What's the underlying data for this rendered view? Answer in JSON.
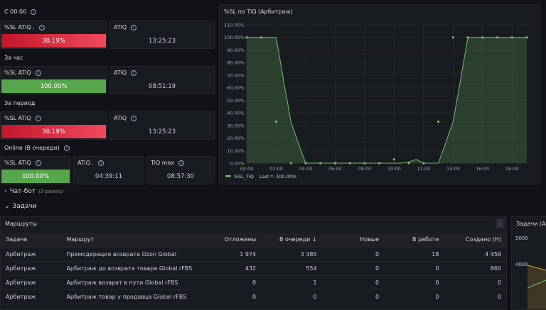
{
  "left": {
    "sec1": "С 00:00",
    "sec2": "За час",
    "sec3": "За период",
    "sec4": "Online (В очереди)",
    "s1_title": "%SL ATiQ .",
    "s1_value": "30.19%",
    "s2_title": "ATiQ",
    "s2_value": "13:25:23",
    "s3_title": "%SL ATiQ",
    "s3_value": "100.00%",
    "s4_title": "ATiQ",
    "s4_value": "08:51:19",
    "s5_title": "%SL ATiQ",
    "s5_value": "30.19%",
    "s6_title": "ATiQ",
    "s6_value": "13:25:23",
    "s7_title": "%SL ATiQ",
    "s7_value": "100.00%",
    "s8_title": "ATiQ .",
    "s8_value": "04:39:11",
    "s9_title": "TiQ max",
    "s9_value": "08:57:30"
  },
  "chart_panel_title": "%SL по TiQ (Арбитраж)",
  "legend": {
    "name": "%SL_TiQ",
    "last": "Last *: 100.00%"
  },
  "chart_data": {
    "type": "line",
    "x": [
      "00:00",
      "00:30",
      "01:00",
      "01:30",
      "02:00",
      "02:30",
      "03:00",
      "03:30",
      "04:00",
      "04:30",
      "05:00",
      "05:30",
      "06:00",
      "06:30",
      "07:00",
      "07:30",
      "08:00",
      "08:30",
      "09:00",
      "09:30",
      "10:00",
      "10:30",
      "11:00",
      "11:30",
      "12:00",
      "12:30",
      "13:00",
      "13:30",
      "14:00",
      "14:30",
      "15:00",
      "15:30",
      "16:00",
      "16:30",
      "17:00",
      "17:30",
      "18:00",
      "18:30",
      "19:00"
    ],
    "values": [
      100,
      100,
      100,
      100,
      100,
      66,
      33,
      16,
      0,
      0,
      0,
      0,
      0,
      0,
      0,
      0,
      0,
      0,
      0,
      0,
      0,
      0,
      1,
      3,
      0,
      0,
      0,
      16,
      33,
      66,
      100,
      100,
      100,
      100,
      100,
      100,
      100,
      100,
      100
    ],
    "point_x": [
      "00:00",
      "01:00",
      "02:00",
      "03:00",
      "04:00",
      "05:00",
      "06:00",
      "07:00",
      "08:00",
      "09:00",
      "10:00",
      "11:00",
      "12:00",
      "13:00",
      "14:00",
      "15:00",
      "16:00",
      "17:00",
      "18:00",
      "19:00"
    ],
    "point_values": [
      100,
      100,
      33,
      0,
      0,
      0,
      0,
      0,
      0,
      0,
      3,
      0,
      0,
      33,
      100,
      100,
      100,
      100,
      100,
      100
    ],
    "yticks": [
      "110.00%",
      "100.00%",
      "90.00%",
      "80.00%",
      "70.00%",
      "60.00%",
      "50.00%",
      "40.00%",
      "30.00%",
      "20.00%",
      "10.00%",
      "0.00%"
    ],
    "xticks": [
      "00:00",
      "02:00",
      "04:00",
      "06:00",
      "08:00",
      "10:00",
      "12:00",
      "14:00",
      "16:00",
      "18:00"
    ],
    "ylim": [
      0,
      110
    ],
    "series_color": "#73bf69"
  },
  "rows": {
    "chat": "Чат-бот",
    "chat_note": "(3 panels)",
    "tasks": "Задачи"
  },
  "routes": {
    "title": "Маршруты",
    "headers": [
      "Задача",
      "Маршрут",
      "Отложены",
      "В очереди ↓",
      "Новые",
      "В работе",
      "Создано (Н)"
    ],
    "rows": [
      [
        "Арбитраж",
        "Премодерация возврата Ozon Global",
        "1 974",
        "3 385",
        "0",
        "18",
        "4 459"
      ],
      [
        "Арбитраж",
        "Арбитраж до возврата товара Global rFBS",
        "432",
        "554",
        "0",
        "0",
        "860"
      ],
      [
        "Арбитраж",
        "Арбитраж возврат в пути Global rFBS",
        "0",
        "1",
        "0",
        "0",
        "0"
      ],
      [
        "Арбитраж",
        "Арбитраж товар у продавца Global rFBS",
        "0",
        "0",
        "0",
        "0",
        "0"
      ]
    ]
  },
  "right_panel": {
    "title": "Задачи (Ар",
    "y1": "5000",
    "y2": "4000"
  }
}
